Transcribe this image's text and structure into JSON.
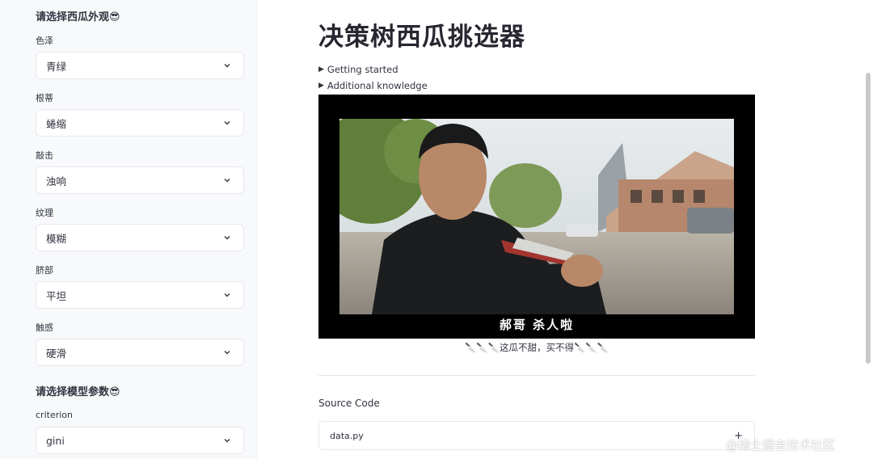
{
  "sidebar": {
    "appearance_header": "请选择西瓜外观😎",
    "model_header": "请选择模型参数😎",
    "fields": [
      {
        "label": "色泽",
        "value": "青绿"
      },
      {
        "label": "根蒂",
        "value": "蜷缩"
      },
      {
        "label": "敲击",
        "value": "浊响"
      },
      {
        "label": "纹理",
        "value": "模糊"
      },
      {
        "label": "脐部",
        "value": "平坦"
      },
      {
        "label": "触感",
        "value": "硬滑"
      }
    ],
    "criterion": {
      "label": "criterion",
      "value": "gini"
    }
  },
  "main": {
    "title": "决策树西瓜挑选器",
    "expanders": [
      "Getting started",
      "Additional knowledge"
    ],
    "video_subtitle": "郝哥  杀人啦",
    "caption": "🔪🔪🔪这瓜不甜，买不得🔪🔪🔪",
    "source_code_label": "Source Code",
    "code_file": "data.py",
    "code_toggle": "+"
  },
  "watermark": "@稀土掘金技术社区",
  "colors": {
    "sidebar_bg": "#f8f9fb",
    "text": "#31333f",
    "border": "#e6e8ee",
    "video_bg": "#000000"
  },
  "icons": {
    "dropdown": "chevron-down-icon",
    "expand": "play-triangle-icon"
  }
}
